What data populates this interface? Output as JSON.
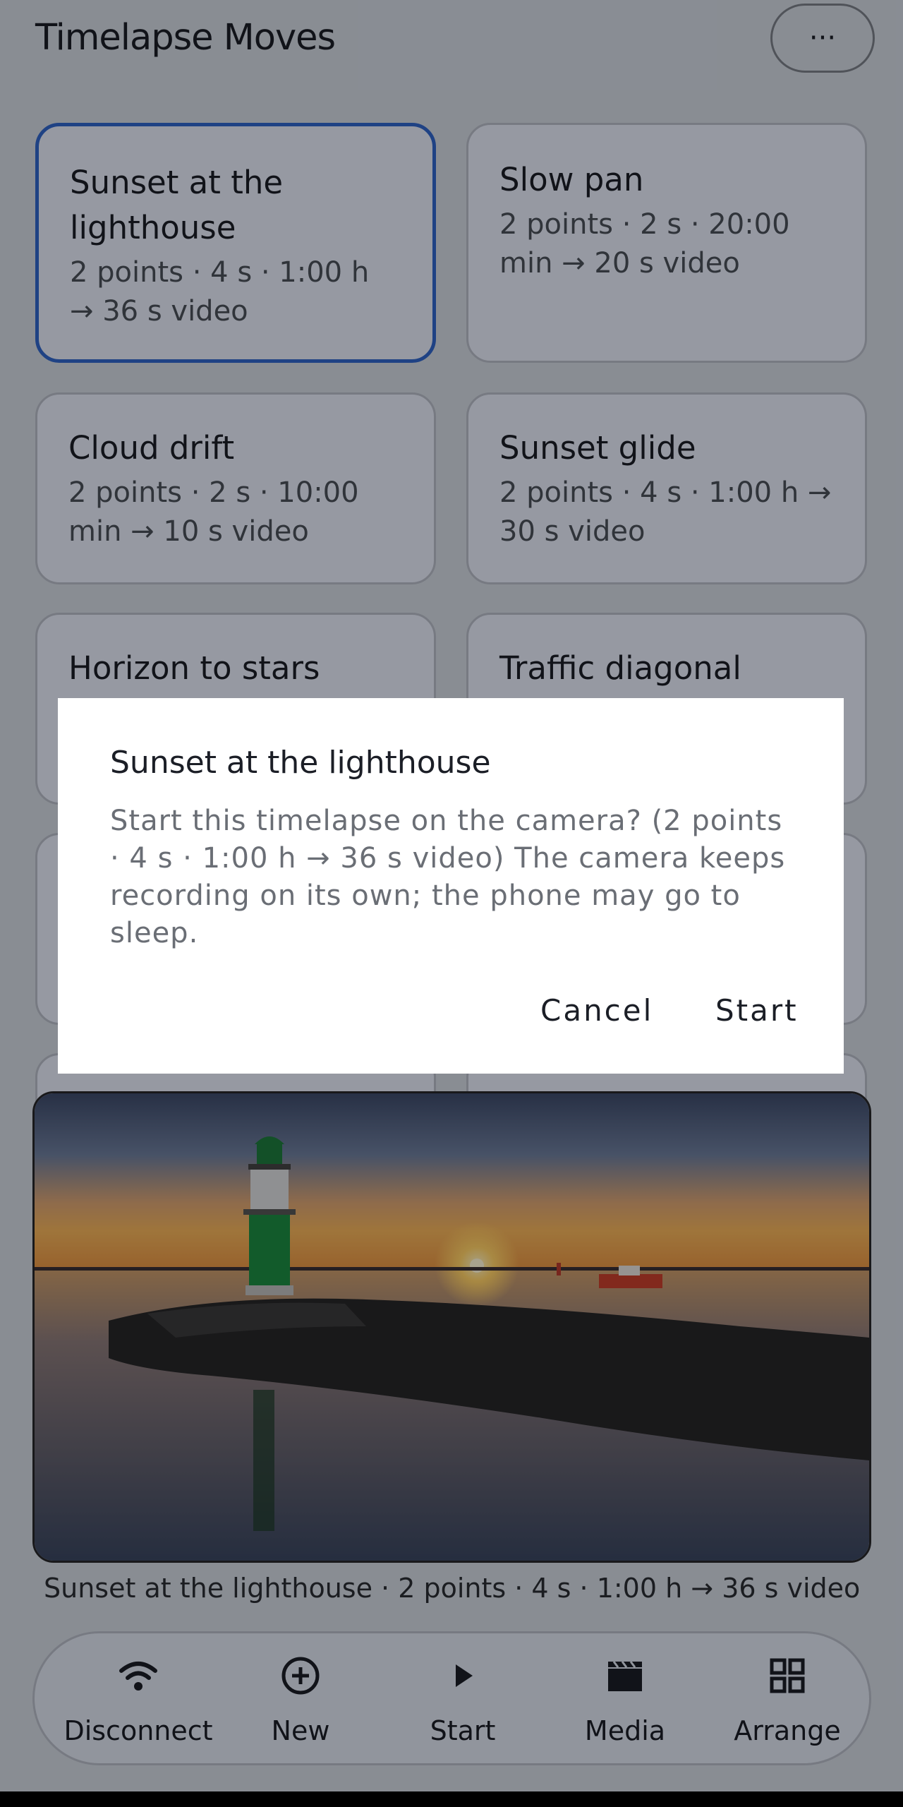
{
  "header": {
    "title": "Timelapse Moves",
    "more_label": "···"
  },
  "cards": [
    {
      "title": "Sunset at the lighthouse",
      "subtitle": "2 points · 4 s · 1:00 h → 36 s video"
    },
    {
      "title": "Slow pan",
      "subtitle": "2 points · 2 s · 20:00 min → 20 s video"
    },
    {
      "title": "Cloud drift",
      "subtitle": "2 points · 2 s · 10:00 min → 10 s video"
    },
    {
      "title": "Sunset glide",
      "subtitle": "2 points · 4 s · 1:00 h → 30 s video"
    },
    {
      "title": "Horizon to stars",
      "subtitle": ""
    },
    {
      "title": "Traffic diagonal",
      "subtitle": ""
    }
  ],
  "preview": {
    "caption": "Sunset at the lighthouse  ·  2 points · 4 s · 1:00 h → 36 s video"
  },
  "bottom_nav": [
    {
      "label": "Disconnect",
      "icon": "wifi-icon"
    },
    {
      "label": "New",
      "icon": "add-circle-icon"
    },
    {
      "label": "Start",
      "icon": "play-icon"
    },
    {
      "label": "Media",
      "icon": "clapperboard-icon"
    },
    {
      "label": "Arrange",
      "icon": "grid-icon"
    }
  ],
  "dialog": {
    "title": "Sunset at the lighthouse",
    "body": "Start this timelapse on the camera? (2 points · 4 s · 1:00 h → 36 s video) The camera keeps recording on its own; the phone may go to sleep.",
    "cancel_label": "Cancel",
    "start_label": "Start"
  },
  "colors": {
    "selected_border": "#2f64c8",
    "card_bg": "#e4e9f6",
    "screen_bg": "#d0d6e0"
  }
}
